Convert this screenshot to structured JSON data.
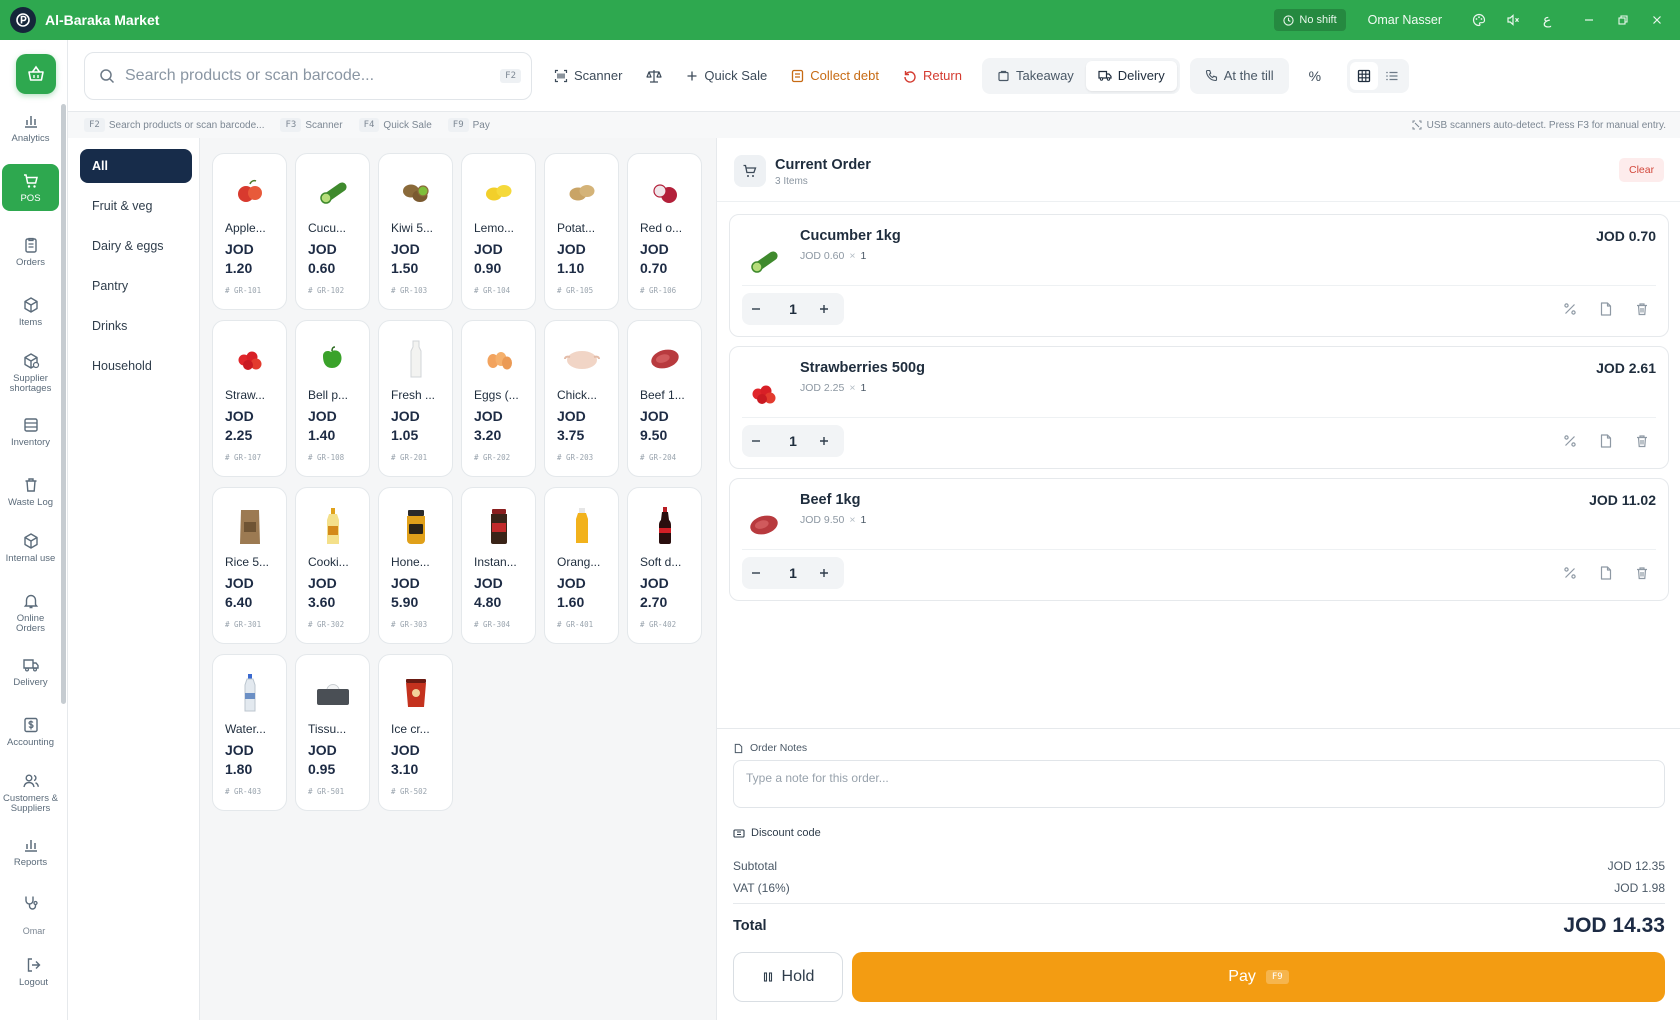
{
  "app": {
    "title": "Al-Baraka Market",
    "shift_status": "No shift",
    "user_name": "Omar Nasser"
  },
  "colors": {
    "brand": "#2ea84f",
    "category_selected": "#172c4a",
    "pay": "#f39c12",
    "danger": "#d43b30",
    "collect": "#c76b14"
  },
  "sidebar": {
    "items": [
      {
        "label": "Analytics",
        "icon": "bar-chart-icon"
      },
      {
        "label": "POS",
        "icon": "cart-icon",
        "active": true
      },
      {
        "label": "Orders",
        "icon": "clipboard-icon"
      },
      {
        "label": "Items",
        "icon": "box-icon"
      },
      {
        "label": "Supplier shortages",
        "icon": "box-alert-icon"
      },
      {
        "label": "Inventory",
        "icon": "inventory-icon"
      },
      {
        "label": "Waste Log",
        "icon": "trash-icon"
      },
      {
        "label": "Internal use",
        "icon": "box-icon"
      },
      {
        "label": "Online Orders",
        "icon": "bell-icon"
      },
      {
        "label": "Delivery",
        "icon": "truck-icon"
      },
      {
        "label": "Accounting",
        "icon": "dollar-icon"
      },
      {
        "label": "Customers & Suppliers",
        "icon": "users-icon"
      },
      {
        "label": "Reports",
        "icon": "bar-chart-icon"
      }
    ],
    "footer_user": "Omar",
    "logout_label": "Logout"
  },
  "toolbar": {
    "search_placeholder": "Search products or scan barcode...",
    "search_key": "F2",
    "scanner": "Scanner",
    "quick_sale": "Quick Sale",
    "collect_debt": "Collect debt",
    "return": "Return",
    "takeaway": "Takeaway",
    "delivery": "Delivery",
    "at_the_till": "At the till",
    "discount_symbol": "%"
  },
  "shortcuts": [
    {
      "key": "F2",
      "label": "Search products or scan barcode..."
    },
    {
      "key": "F3",
      "label": "Scanner"
    },
    {
      "key": "F4",
      "label": "Quick Sale"
    },
    {
      "key": "F9",
      "label": "Pay"
    }
  ],
  "shortcut_hint": "USB scanners auto-detect. Press F3 for manual entry.",
  "categories": [
    "All",
    "Fruit & veg",
    "Dairy & eggs",
    "Pantry",
    "Drinks",
    "Household"
  ],
  "products": [
    {
      "name": "Apple...",
      "currency": "JOD",
      "price": "1.20",
      "sku": "# GR-101",
      "icon": "apple-icon"
    },
    {
      "name": "Cucu...",
      "currency": "JOD",
      "price": "0.60",
      "sku": "# GR-102",
      "icon": "cucumber-icon"
    },
    {
      "name": "Kiwi 5...",
      "currency": "JOD",
      "price": "1.50",
      "sku": "# GR-103",
      "icon": "kiwi-icon"
    },
    {
      "name": "Lemo...",
      "currency": "JOD",
      "price": "0.90",
      "sku": "# GR-104",
      "icon": "lemon-icon"
    },
    {
      "name": "Potat...",
      "currency": "JOD",
      "price": "1.10",
      "sku": "# GR-105",
      "icon": "potato-icon"
    },
    {
      "name": "Red o...",
      "currency": "JOD",
      "price": "0.70",
      "sku": "# GR-106",
      "icon": "onion-icon"
    },
    {
      "name": "Straw...",
      "currency": "JOD",
      "price": "2.25",
      "sku": "# GR-107",
      "icon": "strawberry-icon"
    },
    {
      "name": "Bell p...",
      "currency": "JOD",
      "price": "1.40",
      "sku": "# GR-108",
      "icon": "pepper-icon"
    },
    {
      "name": "Fresh ...",
      "currency": "JOD",
      "price": "1.05",
      "sku": "# GR-201",
      "icon": "milk-icon"
    },
    {
      "name": "Eggs (...",
      "currency": "JOD",
      "price": "3.20",
      "sku": "# GR-202",
      "icon": "eggs-icon"
    },
    {
      "name": "Chick...",
      "currency": "JOD",
      "price": "3.75",
      "sku": "# GR-203",
      "icon": "chicken-icon"
    },
    {
      "name": "Beef 1...",
      "currency": "JOD",
      "price": "9.50",
      "sku": "# GR-204",
      "icon": "beef-icon"
    },
    {
      "name": "Rice 5...",
      "currency": "JOD",
      "price": "6.40",
      "sku": "# GR-301",
      "icon": "rice-bag-icon"
    },
    {
      "name": "Cooki...",
      "currency": "JOD",
      "price": "3.60",
      "sku": "# GR-302",
      "icon": "oil-bottle-icon"
    },
    {
      "name": "Hone...",
      "currency": "JOD",
      "price": "5.90",
      "sku": "# GR-303",
      "icon": "honey-jar-icon"
    },
    {
      "name": "Instan...",
      "currency": "JOD",
      "price": "4.80",
      "sku": "# GR-304",
      "icon": "coffee-jar-icon"
    },
    {
      "name": "Orang...",
      "currency": "JOD",
      "price": "1.60",
      "sku": "# GR-401",
      "icon": "juice-bottle-icon"
    },
    {
      "name": "Soft d...",
      "currency": "JOD",
      "price": "2.70",
      "sku": "# GR-402",
      "icon": "soda-bottle-icon"
    },
    {
      "name": "Water...",
      "currency": "JOD",
      "price": "1.80",
      "sku": "# GR-403",
      "icon": "water-bottle-icon"
    },
    {
      "name": "Tissu...",
      "currency": "JOD",
      "price": "0.95",
      "sku": "# GR-501",
      "icon": "tissue-box-icon"
    },
    {
      "name": "Ice cr...",
      "currency": "JOD",
      "price": "3.10",
      "sku": "# GR-502",
      "icon": "ice-cream-icon"
    }
  ],
  "order": {
    "title": "Current Order",
    "count_label": "3 Items",
    "clear_label": "Clear",
    "lines": [
      {
        "name": "Cucumber 1kg",
        "unit_price": "JOD 0.60",
        "times": "×",
        "unit_qty": "1",
        "total": "JOD 0.70",
        "qty": "1",
        "icon": "cucumber-icon"
      },
      {
        "name": "Strawberries 500g",
        "unit_price": "JOD 2.25",
        "times": "×",
        "unit_qty": "1",
        "total": "JOD 2.61",
        "qty": "1",
        "icon": "strawberry-icon"
      },
      {
        "name": "Beef 1kg",
        "unit_price": "JOD 9.50",
        "times": "×",
        "unit_qty": "1",
        "total": "JOD 11.02",
        "qty": "1",
        "icon": "beef-icon"
      }
    ],
    "notes_label": "Order Notes",
    "notes_placeholder": "Type a note for this order...",
    "discount_label": "Discount code",
    "subtotal_label": "Subtotal",
    "subtotal": "JOD 12.35",
    "vat_label": "VAT (16%)",
    "vat": "JOD 1.98",
    "total_label": "Total",
    "total": "JOD 14.33",
    "hold_label": "Hold",
    "pay_label": "Pay",
    "pay_key": "F9"
  }
}
